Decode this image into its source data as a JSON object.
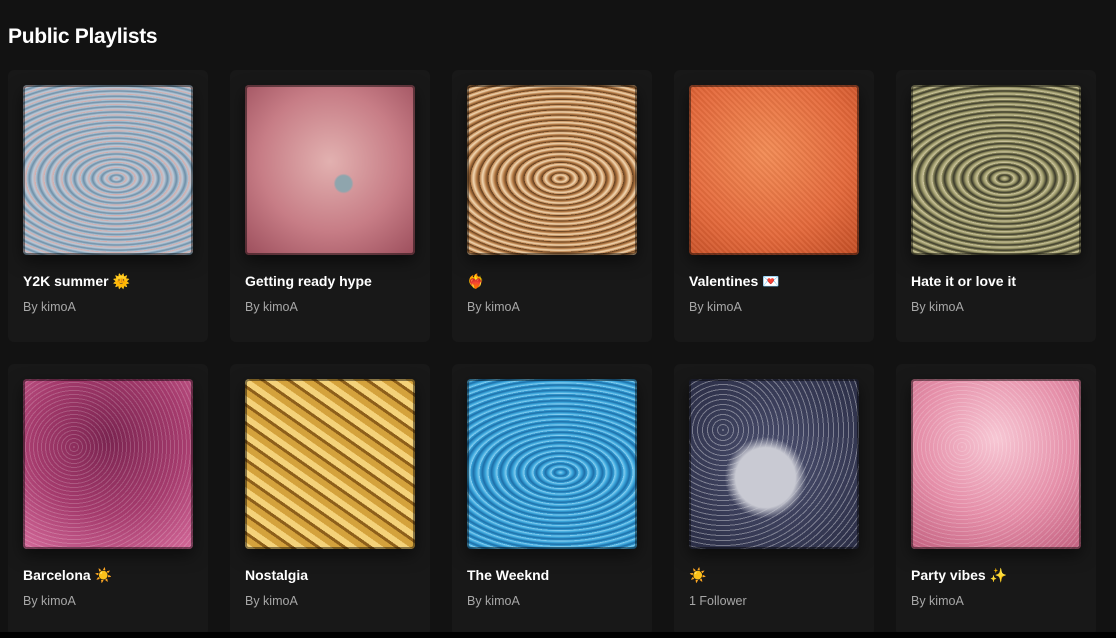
{
  "section": {
    "title": "Public Playlists"
  },
  "playlists": [
    {
      "title": "Y2K summer 🌞",
      "subtitle": "By kimoA",
      "cover": "swirl-silver-blue",
      "colors": [
        "#b9c9d8",
        "#6d8fa8",
        "#d7a9a5"
      ]
    },
    {
      "title": "Getting ready hype",
      "subtitle": "By kimoA",
      "cover": "satin-rose",
      "colors": [
        "#c77d86",
        "#e2b1b0",
        "#9c4e5c"
      ]
    },
    {
      "title": "❤️‍🔥",
      "subtitle": "By kimoA",
      "cover": "swirl-bronze",
      "colors": [
        "#b57a44",
        "#f2d7b2",
        "#5c3a1d"
      ]
    },
    {
      "title": "Valentines 💌",
      "subtitle": "By kimoA",
      "cover": "matte-orange",
      "colors": [
        "#e5693b",
        "#f38c55",
        "#c44e25"
      ]
    },
    {
      "title": "Hate it or love it",
      "subtitle": "By kimoA",
      "cover": "swirl-olive",
      "colors": [
        "#9d9a6a",
        "#3b3a2a",
        "#cfc7a0"
      ]
    },
    {
      "title": "Barcelona ☀️",
      "subtitle": "By kimoA",
      "cover": "shimmer-magenta",
      "colors": [
        "#a53b6d",
        "#7a2450",
        "#d46a9a"
      ]
    },
    {
      "title": "Nostalgia",
      "subtitle": "By kimoA",
      "cover": "foil-gold",
      "colors": [
        "#d4a23c",
        "#f4d27a",
        "#8d5f1a"
      ]
    },
    {
      "title": "The Weeknd",
      "subtitle": "By kimoA",
      "cover": "swirl-blue",
      "colors": [
        "#3aa6dc",
        "#1d6ea8",
        "#8fd3f2"
      ]
    },
    {
      "title": "☀️",
      "subtitle": "1 Follower",
      "cover": "glitter-navy",
      "colors": [
        "#2a2d45",
        "#c9cad3",
        "#4c5070"
      ]
    },
    {
      "title": "Party vibes ✨",
      "subtitle": "By kimoA",
      "cover": "shimmer-pink",
      "colors": [
        "#e58fa9",
        "#f7c7d4",
        "#c2607f"
      ]
    }
  ]
}
